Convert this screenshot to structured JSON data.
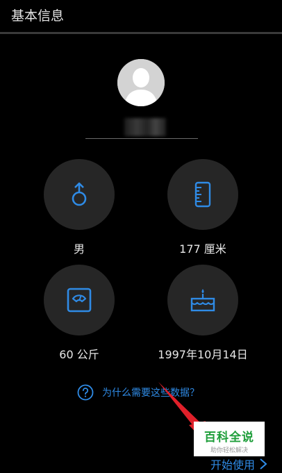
{
  "header": {
    "title": "基本信息"
  },
  "profile": {
    "avatar_icon": "default-user-avatar-icon"
  },
  "stats": {
    "gender": {
      "label": "男",
      "icon": "male-icon"
    },
    "height": {
      "label": "177 厘米",
      "icon": "ruler-icon"
    },
    "weight": {
      "label": "60 公斤",
      "icon": "scale-icon"
    },
    "birthday": {
      "label": "1997年10月14日",
      "icon": "birthday-cake-icon"
    }
  },
  "help": {
    "text": "为什么需要这些数据？",
    "icon": "question-circle-icon"
  },
  "watermark": {
    "title": "百科全说",
    "subtitle": "助你轻松解决"
  },
  "footer": {
    "start_label": "开始使用",
    "icon": "chevron-right-icon"
  },
  "colors": {
    "background": "#000000",
    "accent": "#2f8be6",
    "circle": "#262626",
    "watermark_green": "#1e9e3a",
    "annotation_arrow": "#e0202a"
  }
}
